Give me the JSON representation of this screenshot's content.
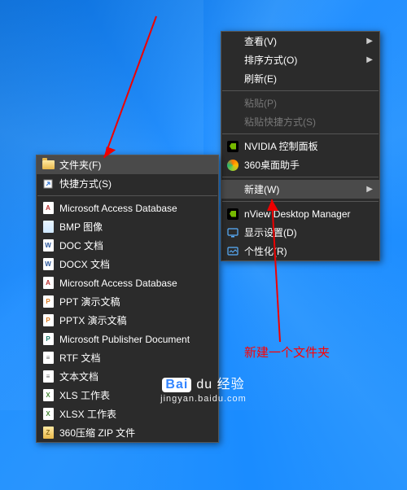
{
  "main_menu": {
    "view": "查看(V)",
    "sort": "排序方式(O)",
    "refresh": "刷新(E)",
    "paste": "粘贴(P)",
    "paste_shortcut": "粘贴快捷方式(S)",
    "nvidia": "NVIDIA 控制面板",
    "d360": "360桌面助手",
    "new": "新建(W)",
    "nview": "nView Desktop Manager",
    "display": "显示设置(D)",
    "personalize": "个性化(R)"
  },
  "new_menu": {
    "folder": "文件夹(F)",
    "shortcut": "快捷方式(S)",
    "access": "Microsoft Access Database",
    "bmp": "BMP 图像",
    "doc": "DOC 文档",
    "docx": "DOCX 文档",
    "access2": "Microsoft Access Database",
    "ppt": "PPT 演示文稿",
    "pptx": "PPTX 演示文稿",
    "pub": "Microsoft Publisher Document",
    "rtf": "RTF 文档",
    "txt": "文本文档",
    "xls": "XLS 工作表",
    "xlsx": "XLSX 工作表",
    "zip": "360压缩 ZIP 文件"
  },
  "annotation": "新建一个文件夹",
  "watermark": {
    "brand": "Bai",
    "du": "du",
    "product": "经验",
    "url": "jingyan.baidu.com"
  }
}
